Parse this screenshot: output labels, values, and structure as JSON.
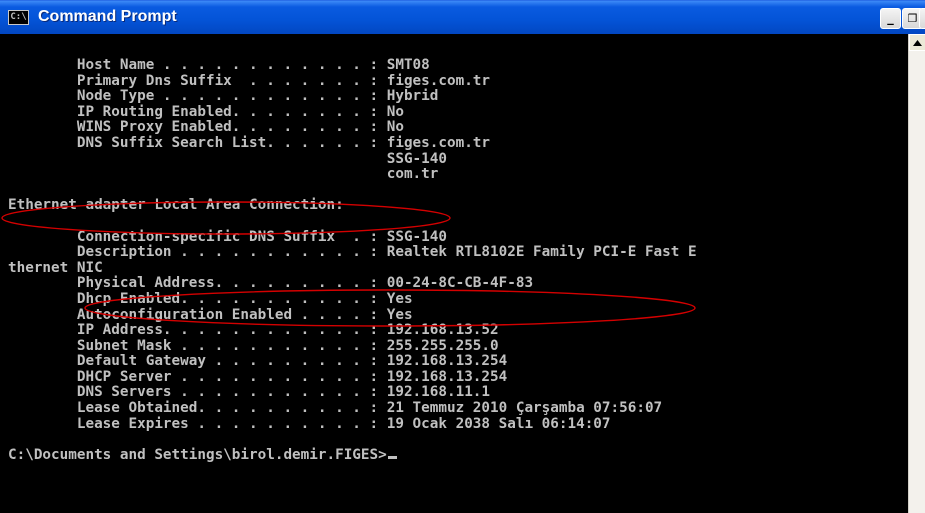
{
  "window": {
    "title": "Command Prompt",
    "icon_text": "C:\\",
    "buttons": {
      "minimize": "_",
      "maximize": "❐",
      "close": "✕"
    }
  },
  "console": {
    "lines": [
      "        Host Name . . . . . . . . . . . . : SMT08",
      "        Primary Dns Suffix  . . . . . . . : figes.com.tr",
      "        Node Type . . . . . . . . . . . . : Hybrid",
      "        IP Routing Enabled. . . . . . . . : No",
      "        WINS Proxy Enabled. . . . . . . . : No",
      "        DNS Suffix Search List. . . . . . : figes.com.tr",
      "                                            SSG-140",
      "                                            com.tr",
      "",
      "Ethernet adapter Local Area Connection:",
      "",
      "        Connection-specific DNS Suffix  . : SSG-140",
      "        Description . . . . . . . . . . . : Realtek RTL8102E Family PCI-E Fast E",
      "thernet NIC",
      "        Physical Address. . . . . . . . . : 00-24-8C-CB-4F-83",
      "        Dhcp Enabled. . . . . . . . . . . : Yes",
      "        Autoconfiguration Enabled . . . . : Yes",
      "        IP Address. . . . . . . . . . . . : 192.168.13.52",
      "        Subnet Mask . . . . . . . . . . . : 255.255.255.0",
      "        Default Gateway . . . . . . . . . : 192.168.13.254",
      "        DHCP Server . . . . . . . . . . . : 192.168.13.254",
      "        DNS Servers . . . . . . . . . . . : 192.168.11.1",
      "        Lease Obtained. . . . . . . . . . : 21 Temmuz 2010 Çarşamba 07:56:07",
      "        Lease Expires . . . . . . . . . . : 19 Ocak 2038 Salı 06:14:07",
      "",
      "C:\\Documents and Settings\\birol.demir.FIGES>"
    ]
  },
  "colors": {
    "titlebar": "#0454d8",
    "console_bg": "#000000",
    "console_text": "#c0c0c0",
    "annotation": "#d40000"
  }
}
